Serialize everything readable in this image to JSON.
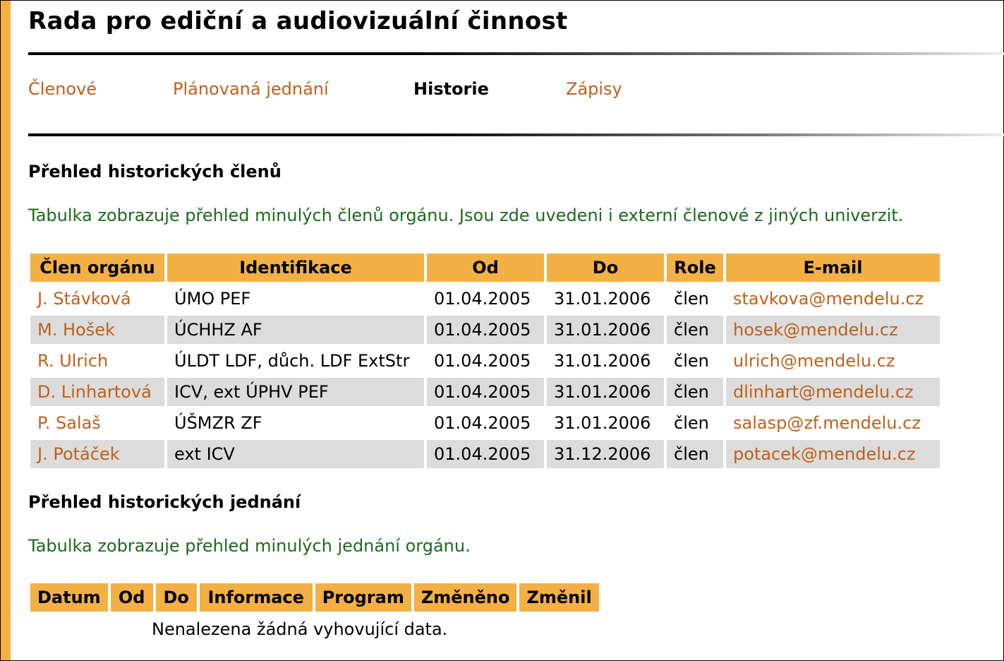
{
  "page": {
    "title": "Rada pro ediční a audiovizuální činnost"
  },
  "tabs": [
    {
      "label": "Členové",
      "active": false
    },
    {
      "label": "Plánovaná jednání",
      "active": false
    },
    {
      "label": "Historie",
      "active": true
    },
    {
      "label": "Zápisy",
      "active": false
    }
  ],
  "members_section": {
    "heading": "Přehled historických členů",
    "description": "Tabulka zobrazuje přehled minulých členů orgánu. Jsou zde uvedeni i externí členové z jiných univerzit.",
    "columns": [
      "Člen orgánu",
      "Identifikace",
      "Od",
      "Do",
      "Role",
      "E-mail"
    ],
    "rows": [
      {
        "name": "J. Stávková",
        "id": "ÚMO PEF",
        "from": "01.04.2005",
        "to": "31.01.2006",
        "role": "člen",
        "email": "stavkova@mendelu.cz"
      },
      {
        "name": "M. Hošek",
        "id": "ÚCHHZ AF",
        "from": "01.04.2005",
        "to": "31.01.2006",
        "role": "člen",
        "email": "hosek@mendelu.cz"
      },
      {
        "name": "R. Ulrich",
        "id": "ÚLDT LDF, důch. LDF ExtStr",
        "from": "01.04.2005",
        "to": "31.01.2006",
        "role": "člen",
        "email": "ulrich@mendelu.cz"
      },
      {
        "name": "D. Linhartová",
        "id": "ICV, ext ÚPHV PEF",
        "from": "01.04.2005",
        "to": "31.01.2006",
        "role": "člen",
        "email": "dlinhart@mendelu.cz"
      },
      {
        "name": "P. Salaš",
        "id": "ÚŠMZR ZF",
        "from": "01.04.2005",
        "to": "31.01.2006",
        "role": "člen",
        "email": "salasp@zf.mendelu.cz"
      },
      {
        "name": "J. Potáček",
        "id": "ext ICV",
        "from": "01.04.2005",
        "to": "31.12.2006",
        "role": "člen",
        "email": "potacek@mendelu.cz"
      }
    ]
  },
  "meetings_section": {
    "heading": "Přehled historických jednání",
    "description": "Tabulka zobrazuje přehled minulých jednání orgánu.",
    "columns": [
      "Datum",
      "Od",
      "Do",
      "Informace",
      "Program",
      "Změněno",
      "Změnil"
    ],
    "empty_text": "Nenalezena žádná vyhovující data."
  },
  "colors": {
    "accent": "#f3b044",
    "link": "#c0601a",
    "description": "#1b6b1b",
    "row_alt": "#dcdcdc"
  }
}
